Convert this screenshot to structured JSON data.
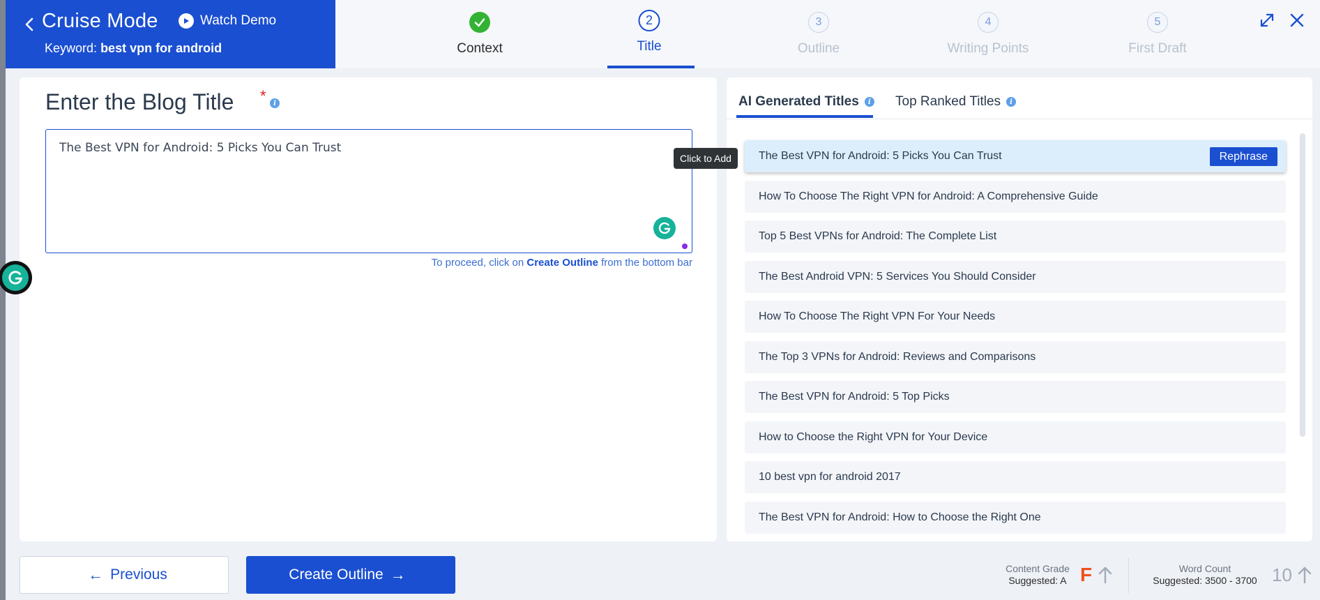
{
  "header": {
    "title": "Cruise Mode",
    "watch_demo": "Watch Demo",
    "keyword_label": "Keyword:",
    "keyword": "best vpn for android",
    "steps": [
      {
        "num": "",
        "label": "Context",
        "state": "done"
      },
      {
        "num": "2",
        "label": "Title",
        "state": "active"
      },
      {
        "num": "3",
        "label": "Outline",
        "state": "pending"
      },
      {
        "num": "4",
        "label": "Writing Points",
        "state": "pending"
      },
      {
        "num": "5",
        "label": "First Draft",
        "state": "pending"
      }
    ],
    "icons": {
      "back": "chevron-left-icon",
      "play": "play-icon",
      "expand": "expand-icon",
      "close": "close-icon",
      "done": "check-icon"
    }
  },
  "editor": {
    "heading": "Enter the Blog Title",
    "required_mark": "*",
    "info_glyph": "i",
    "value": "The Best VPN for Android: 5 Picks You Can Trust",
    "hint_prefix": "To proceed, click on",
    "hint_link": "Create Outline",
    "hint_suffix": "from the bottom bar"
  },
  "suggestions": {
    "tabs": [
      {
        "label": "AI Generated Titles",
        "active": true
      },
      {
        "label": "Top Ranked Titles",
        "active": false
      }
    ],
    "tooltip": "Click to Add",
    "rephrase_label": "Rephrase",
    "items": [
      {
        "text": "The Best VPN for Android: 5 Picks You Can Trust",
        "selected": true
      },
      {
        "text": "How To Choose The Right VPN for Android: A Comprehensive Guide",
        "selected": false
      },
      {
        "text": "Top 5 Best VPNs for Android: The Complete List",
        "selected": false
      },
      {
        "text": "The Best Android VPN: 5 Services You Should Consider",
        "selected": false
      },
      {
        "text": "How To Choose The Right VPN For Your Needs",
        "selected": false
      },
      {
        "text": "The Top 3 VPNs for Android: Reviews and Comparisons",
        "selected": false
      },
      {
        "text": "The Best VPN for Android: 5 Top Picks",
        "selected": false
      },
      {
        "text": "How to Choose the Right VPN for Your Device",
        "selected": false
      },
      {
        "text": "10 best vpn for android 2017",
        "selected": false
      },
      {
        "text": "The Best VPN for Android: How to Choose the Right One",
        "selected": false
      }
    ]
  },
  "footer": {
    "previous_label": "Previous",
    "create_outline_label": "Create Outline",
    "content_grade_label": "Content Grade",
    "content_grade_suggested": "Suggested: A",
    "content_grade_value": "F",
    "word_count_label": "Word Count",
    "word_count_suggested": "Suggested: 3500 - 3700",
    "word_count_value": "10"
  },
  "colors": {
    "brand_blue": "#1a4fd1",
    "done_green": "#34b234",
    "grade_red": "#f0511f",
    "grammarly_green": "#16b29a",
    "selected_item_bg": "#dceefb"
  }
}
